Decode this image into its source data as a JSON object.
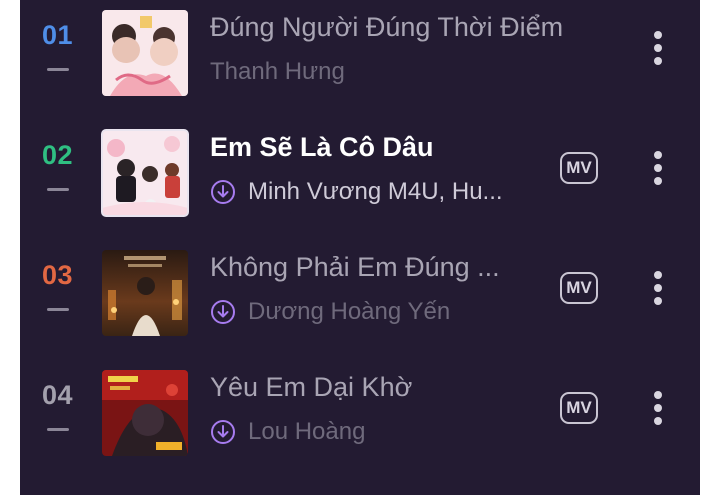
{
  "songs": [
    {
      "rank": "01",
      "rank_color": "#4f8ee8",
      "title": "Đúng Người Đúng Thời Điểm",
      "artist": "Thanh Hưng",
      "active": false,
      "download_icon": false,
      "mv": false,
      "cover": "cover-pink-portrait"
    },
    {
      "rank": "02",
      "rank_color": "#2fbf82",
      "title": "Em Sẽ Là Cô Dâu",
      "artist": "Minh Vương M4U, Hu...",
      "active": true,
      "download_icon": true,
      "mv": true,
      "cover": "cover-wedding"
    },
    {
      "rank": "03",
      "rank_color": "#e26843",
      "title": "Không Phải Em Đúng ...",
      "artist": "Dương Hoàng Yến",
      "active": false,
      "download_icon": true,
      "mv": true,
      "cover": "cover-night-city"
    },
    {
      "rank": "04",
      "rank_color": "#a3a0ad",
      "title": "Yêu Em Dại Khờ",
      "artist": "Lou Hoàng",
      "active": false,
      "download_icon": true,
      "mv": true,
      "cover": "cover-red-poster"
    }
  ],
  "mv_label": "MV",
  "icons": {
    "download": "download-circle-icon",
    "more": "more-vertical-icon"
  },
  "colors": {
    "background": "#231b32",
    "accent": "#a77cf0"
  }
}
